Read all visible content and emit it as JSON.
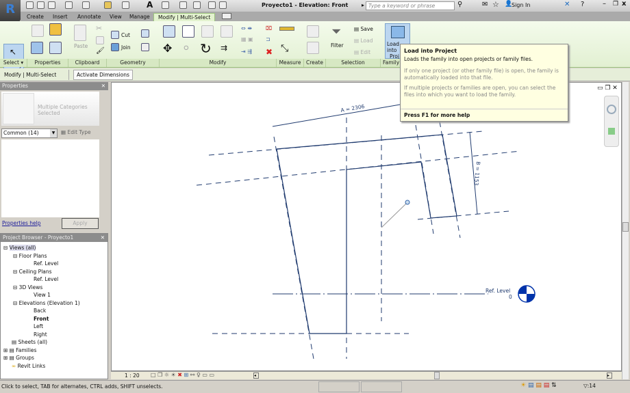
{
  "app": {
    "title": "Proyecto1 - Elevation: Front",
    "logo": "R",
    "search_placeholder": "Type a keyword or phrase",
    "sign_in": "Sign In"
  },
  "tabs": [
    "Create",
    "Insert",
    "Annotate",
    "View",
    "Manage",
    "Modify | Multi-Select"
  ],
  "ribbon": {
    "modify": "Modify",
    "select_panel": "Select",
    "properties_panel": "Properties",
    "clipboard_panel": "Clipboard",
    "paste": "Paste",
    "geometry_panel": "Geometry",
    "cut": "Cut",
    "join": "Join",
    "modify_panel": "Modify",
    "measure_panel": "Measure",
    "create_panel": "Create",
    "selection_panel": "Selection",
    "filter": "Filter",
    "save": "Save",
    "load": "Load",
    "edit": "Edit",
    "family_panel": "Family E",
    "load_into": "Load into",
    "project_short": "Proj"
  },
  "options_bar": {
    "context": "Modify | Multi-Select",
    "activate_dimensions": "Activate Dimensions"
  },
  "tooltip": {
    "title": "Load into Project",
    "desc": "Loads the family into open projects or family files.",
    "p1": "If only one project (or other family file) is open, the family is automatically loaded into that file.",
    "p2": "If multiple projects or families are open, you can select the files into which you want to load the family.",
    "help": "Press F1 for more help"
  },
  "properties": {
    "title": "Properties",
    "type_name": "Multiple Categories Selected",
    "filter": "Common (14)",
    "edit_type": "Edit Type",
    "help": "Properties help",
    "apply": "Apply"
  },
  "browser": {
    "title": "Project Browser - Proyecto1",
    "items": [
      "Views (all)",
      "Floor Plans",
      "Ref. Level",
      "Ceiling Plans",
      "Ref. Level",
      "3D Views",
      "View 1",
      "Elevations (Elevation 1)",
      "Back",
      "Front",
      "Left",
      "Right",
      "Sheets (all)",
      "Families",
      "Groups",
      "Revit Links"
    ]
  },
  "drawing": {
    "dim_a": "A = 2306",
    "dim_b": "B = 1153",
    "level_name": "Ref. Level",
    "level_value": "0",
    "line_color": "#1f3a6e",
    "level_head_color": "#0033aa"
  },
  "view_control": {
    "scale": "1 : 20"
  },
  "status": {
    "message": "Click to select, TAB for alternates, CTRL adds, SHIFT unselects.",
    "filter_count": ":14"
  }
}
